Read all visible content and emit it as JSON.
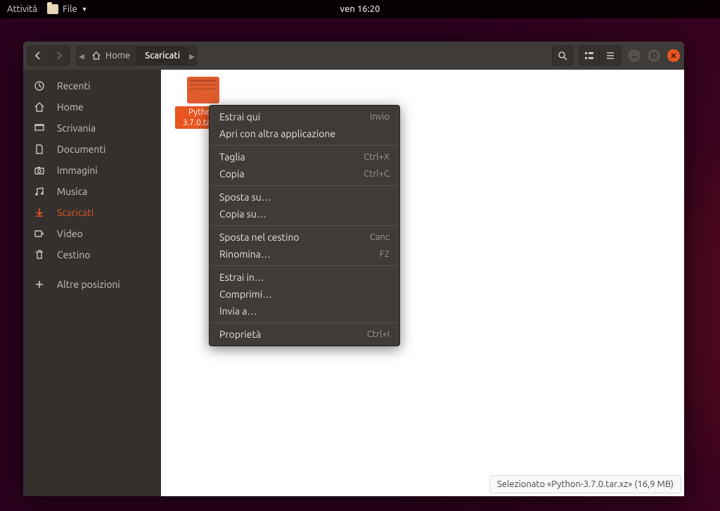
{
  "topbar": {
    "activities": "Attività",
    "files": "File",
    "clock": "ven 16:20"
  },
  "breadcrumb": {
    "home": "Home",
    "current": "Scaricati"
  },
  "sidebar_items": [
    {
      "label": "Recenti"
    },
    {
      "label": "Home"
    },
    {
      "label": "Scrivania"
    },
    {
      "label": "Documenti"
    },
    {
      "label": "Immagini"
    },
    {
      "label": "Musica"
    },
    {
      "label": "Scaricati"
    },
    {
      "label": "Video"
    },
    {
      "label": "Cestino"
    },
    {
      "label": "Altre posizioni"
    }
  ],
  "file": {
    "name_line1": "Python-",
    "name_line2": "3.7.0.tar.xz"
  },
  "context_menu": [
    {
      "label": "Estrai qui",
      "accel": "Invio"
    },
    {
      "label": "Apri con altra applicazione",
      "accel": ""
    },
    {
      "sep": true
    },
    {
      "label": "Taglia",
      "accel": "Ctrl+X"
    },
    {
      "label": "Copia",
      "accel": "Ctrl+C"
    },
    {
      "sep": true
    },
    {
      "label": "Sposta su…",
      "accel": ""
    },
    {
      "label": "Copia su…",
      "accel": ""
    },
    {
      "sep": true
    },
    {
      "label": "Sposta nel cestino",
      "accel": "Canc"
    },
    {
      "label": "Rinomina…",
      "accel": "F2"
    },
    {
      "sep": true
    },
    {
      "label": "Estrai in…",
      "accel": ""
    },
    {
      "label": "Comprimi…",
      "accel": ""
    },
    {
      "label": "Invia a…",
      "accel": ""
    },
    {
      "sep": true
    },
    {
      "label": "Proprietà",
      "accel": "Ctrl+I"
    }
  ],
  "statusbar": "Selezionato «Python-3.7.0.tar.xz»  (16,9 MB)"
}
